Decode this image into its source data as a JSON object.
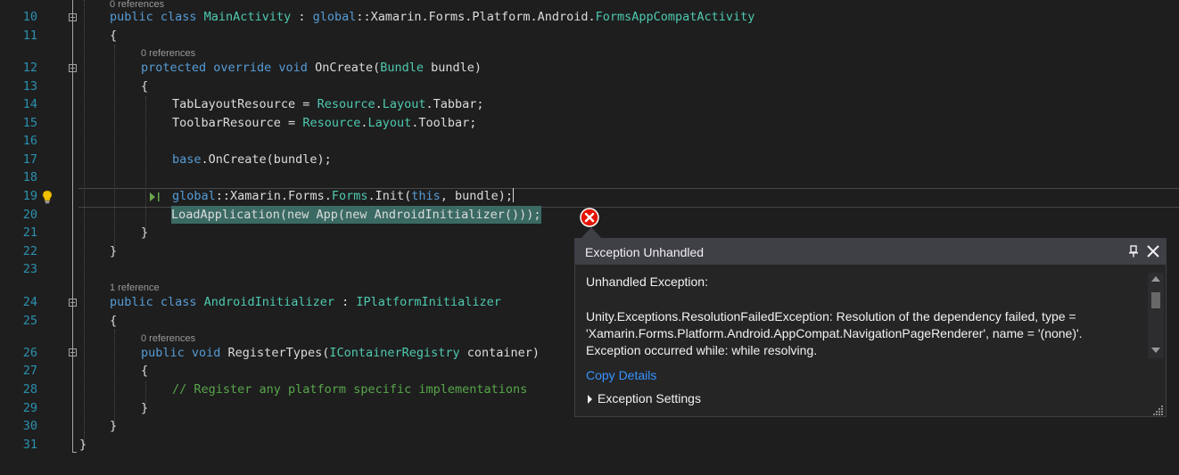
{
  "editor": {
    "lines": [
      {
        "num": "10",
        "refs": "0 references"
      },
      {
        "num": "11"
      },
      {
        "num": "12",
        "refs": "0 references"
      },
      {
        "num": "13"
      },
      {
        "num": "14"
      },
      {
        "num": "15"
      },
      {
        "num": "16"
      },
      {
        "num": "17"
      },
      {
        "num": "18"
      },
      {
        "num": "19"
      },
      {
        "num": "20"
      },
      {
        "num": "21"
      },
      {
        "num": "22"
      },
      {
        "num": "23"
      },
      {
        "num": "24",
        "refs": "1 reference"
      },
      {
        "num": "25"
      },
      {
        "num": "26",
        "refs": "0 references"
      },
      {
        "num": "27"
      },
      {
        "num": "28"
      },
      {
        "num": "29"
      },
      {
        "num": "30"
      },
      {
        "num": "31"
      }
    ],
    "code": {
      "l10": {
        "a": "public class ",
        "b": "MainActivity",
        "c": " : ",
        "d": "global",
        "e": "::Xamarin.Forms.Platform.Android.",
        "f": "FormsAppCompatActivity"
      },
      "l11": "{",
      "l12": {
        "a": "protected override void ",
        "b": "OnCreate(",
        "c": "Bundle",
        "d": " bundle)"
      },
      "l13": "{",
      "l14": {
        "a": "TabLayoutResource = ",
        "b": "Resource",
        "c": ".",
        "d": "Layout",
        "e": ".Tabbar;"
      },
      "l15": {
        "a": "ToolbarResource = ",
        "b": "Resource",
        "c": ".",
        "d": "Layout",
        "e": ".Toolbar;"
      },
      "l17": {
        "a": "base",
        "b": ".OnCreate(bundle);"
      },
      "l19": {
        "a": "global",
        "b": "::Xamarin.Forms.",
        "c": "Forms",
        "d": ".Init(",
        "e": "this",
        "f": ", bundle);"
      },
      "l20": "LoadApplication(new App(new AndroidInitializer()));",
      "l21": "}",
      "l22": "}",
      "l24": {
        "a": "public class ",
        "b": "AndroidInitializer",
        "c": " : ",
        "d": "IPlatformInitializer"
      },
      "l25": "{",
      "l26": {
        "a": "public void ",
        "b": "RegisterTypes(",
        "c": "IContainerRegistry",
        "d": " container)"
      },
      "l27": "{",
      "l28": "// Register any platform specific implementations",
      "l29": "}",
      "l30": "}",
      "l31": "}"
    }
  },
  "popup": {
    "title": "Exception Unhandled",
    "heading": "Unhandled Exception:",
    "message_lines": [
      "Unity.Exceptions.ResolutionFailedException: Resolution of the dependency failed, type =",
      "'Xamarin.Forms.Platform.Android.AppCompat.NavigationPageRenderer', name = '(none)'.",
      "Exception occurred while: while resolving."
    ],
    "copy_details": "Copy Details",
    "exception_settings": "Exception Settings"
  },
  "icons": [
    "lightbulb-icon",
    "next-statement-icon",
    "error-icon",
    "pin-icon",
    "close-icon"
  ],
  "colors": {
    "keyword": "#569cd6",
    "type": "#4ec9b0",
    "comment": "#57a64a",
    "line_number": "#2b91af",
    "link": "#3794ff"
  }
}
